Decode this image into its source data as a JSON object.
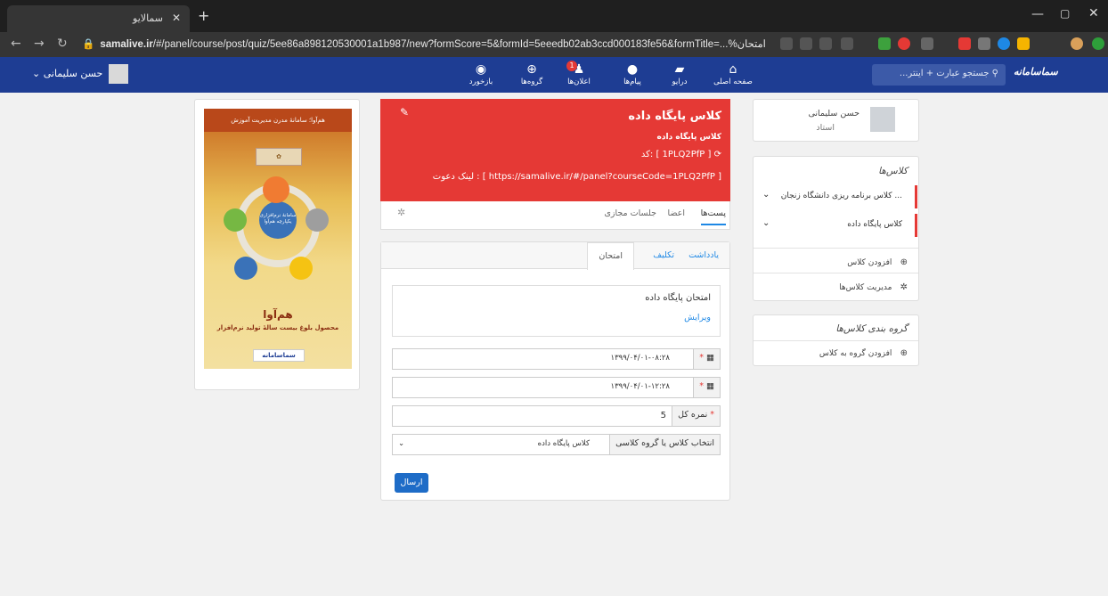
{
  "browser": {
    "tab_title": "سمالایو",
    "tab_close": "✕",
    "new_tab": "+",
    "url_domain": "samalive.ir",
    "url_path": "/#/panel/course/post/quiz/5ee86a898120530001a1b987/new?formScore=5&formId=5eeedb02ab3ccd000183fe56&formTitle=...%امتحان"
  },
  "header": {
    "user_name": "حسن سلیمانی",
    "nav": [
      {
        "label": "بازخورد",
        "icon": "rss-icon"
      },
      {
        "label": "گروه‌ها",
        "icon": "globe-icon"
      },
      {
        "label": "اعلان‌ها",
        "icon": "bell-icon"
      },
      {
        "label": "پیام‌ها",
        "icon": "chat-icon"
      },
      {
        "label": "درایو",
        "icon": "drive-icon"
      },
      {
        "label": "صفحه اصلی",
        "icon": "home-icon"
      }
    ],
    "notif_count": "1",
    "search_placeholder": "جستجو عبارت + اینتر...",
    "logo": "سماسامانه"
  },
  "sidebar": {
    "profile_name": "حسن سلیمانی",
    "profile_role": "استاد",
    "classes_title": "کلاس‌ها",
    "classes": [
      {
        "label": "کلاس برنامه ریزی دانشگاه زنجان ..."
      },
      {
        "label": "کلاس پایگاه داده"
      }
    ],
    "add_class": "افزودن کلاس",
    "manage_classes": "مدیریت کلاس‌ها",
    "groups_title": "گروه بندی کلاس‌ها",
    "add_group": "افزودن گروه به کلاس"
  },
  "banner": {
    "title": "کلاس پایگاه داده",
    "subtitle": "کلاس پایگاه داده",
    "code": "کد: [ 1PLQ2PfP ]",
    "invite": "لینک دعوت : [ https://samalive.ir/#/panel?courseCode=1PLQ2PfP ]",
    "color": "#e53935"
  },
  "class_tabs": {
    "posts": "پست‌ها",
    "members": "اعضا",
    "sessions": "جلسات مجازی"
  },
  "form": {
    "tabs": {
      "note": "یادداشت",
      "assignment": "تکلیف",
      "exam": "امتحان"
    },
    "exam_title": "امتحان پایگاه داده",
    "edit": "ویرایش",
    "start_date": "۱۳۹۹/۰۴/۰۱-۰۸:۲۸",
    "end_date": "۱۳۹۹/۰۴/۰۱-۱۲:۲۸",
    "total_score_label": "نمره کل",
    "total_score": "5",
    "select_label": "انتخاب کلاس یا گروه کلاسی",
    "select_value": "کلاس پایگاه داده",
    "submit": "ارسال"
  },
  "poster": {
    "top_text": "هم‌آوا؛ سامانهٔ مدرن مدیریت آموزش",
    "brand": "هم‌آوا",
    "tagline": "محصول بلوغ بیست سالهٔ تولید نرم‌افزار",
    "logo": "سماسامانه",
    "center": "سامانهٔ نرم‌افزاری یکپارچه هم‌آوا"
  }
}
